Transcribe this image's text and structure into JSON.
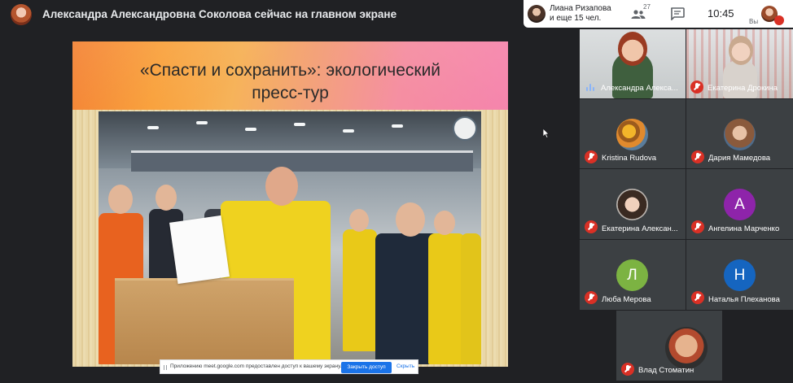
{
  "presenter": {
    "title": "Александра Александровна Соколова сейчас на главном экране"
  },
  "toolbar": {
    "joined_line1": "Лиана Ризапова",
    "joined_line2": "и еще 15 чел.",
    "people_count": "27",
    "time": "10:45",
    "self_label": "Вы"
  },
  "slide": {
    "title_line1": "«Спасти и сохранить»: экологический",
    "title_line2": "пресс-тур"
  },
  "share_notice": {
    "text": "Приложению meet.google.com предоставлен доступ к вашему экрану.",
    "stop_button": "Закрыть доступ",
    "hide_link": "Скрыть"
  },
  "participants": [
    {
      "name": "Александра Алекса...",
      "avatar": "video",
      "color": "#8a5a44",
      "mic": "speaking"
    },
    {
      "name": "Екатерина Дрокина",
      "avatar": "video",
      "color": "#c7b2a3",
      "mic": "muted"
    },
    {
      "name": "Kristina Rudova",
      "avatar": "photo",
      "color": "#d9882a",
      "mic": "muted"
    },
    {
      "name": "Дария Мамедова",
      "avatar": "photo",
      "color": "#a8856b",
      "mic": "muted"
    },
    {
      "name": "Екатерина Алексан...",
      "avatar": "photo",
      "color": "#6a5b52",
      "mic": "muted"
    },
    {
      "name": "Ангелина Марченко",
      "avatar": "А",
      "color": "#8e24aa",
      "mic": "muted"
    },
    {
      "name": "Люба Мерова",
      "avatar": "Л",
      "color": "#7cb342",
      "mic": "muted"
    },
    {
      "name": "Наталья Плеханова",
      "avatar": "Н",
      "color": "#1565c0",
      "mic": "muted"
    },
    {
      "name": "Влад Стоматин",
      "avatar": "photo",
      "color": "#b34a2e",
      "mic": "muted"
    }
  ],
  "icons": {
    "people": "people-icon",
    "chat": "chat-icon",
    "mic_muted": "mic-off-icon",
    "speaking": "audio-level-icon",
    "cursor": "mouse-pointer-icon"
  }
}
